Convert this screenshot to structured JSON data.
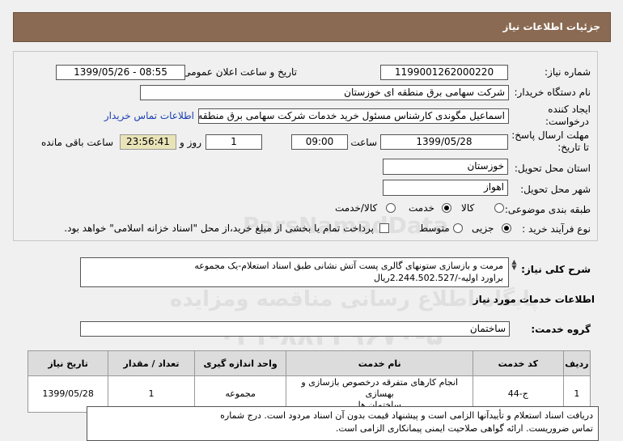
{
  "header": {
    "title": "جزئیات اطلاعات نیاز"
  },
  "form": {
    "need_number_label": "شماره نیاز:",
    "need_number": "1199001262000220",
    "announce_label": "تاریخ و ساعت اعلان عمومی:",
    "announce_value": "1399/05/26 - 08:55",
    "buyer_label": "نام دستگاه خریدار:",
    "buyer_value": "شرکت سهامی برق منطقه ای خوزستان",
    "creator_label_1": "ایجاد کننده",
    "creator_label_2": "درخواست:",
    "creator_value": "اسماعیل مگوندی کارشناس مسئول خرید خدمات شرکت سهامی برق منطقه ای خوزستان",
    "contact_link": "اطلاعات تماس خریدار",
    "deadline_label_1": "مهلت ارسال پاسخ:",
    "deadline_label_2": "تا تاریخ:",
    "deadline_date": "1399/05/28",
    "time_label": "ساعت",
    "deadline_time": "09:00",
    "days_value": "1",
    "days_label": "روز و",
    "countdown": "23:56:41",
    "remaining_label": "ساعت باقی مانده",
    "province_label": "استان محل تحویل:",
    "province_value": "خوزستان",
    "city_label": "شهر محل تحویل:",
    "city_value": "اهواز",
    "category_label": "طبقه بندی موضوعی:",
    "category_options": [
      "کالا",
      "خدمت",
      "کالا/خدمت"
    ],
    "category_selected": "خدمت",
    "process_label": "نوع فرآیند خرید :",
    "process_options": [
      "جزیی",
      "متوسط"
    ],
    "process_selected": "جزیی",
    "payment_note": "پرداخت تمام یا بخشی از مبلغ خرید،از محل \"اسناد خزانه اسلامی\" خواهد بود."
  },
  "description": {
    "label": "شرح کلی نیاز:",
    "line1": "مرمت و بازسازی ستونهای گالری پست آتش نشانی طبق اسناد استعلام-یک مجموعه",
    "line2": "براورد اولیه-/2.244.502.527ریال"
  },
  "services": {
    "section_title": "اطلاعات خدمات مورد نیاز",
    "group_label": "گروه خدمت:",
    "group_value": "ساختمان",
    "columns": [
      "ردیف",
      "کد خدمت",
      "نام خدمت",
      "واحد اندازه گیری",
      "تعداد / مقدار",
      "تاریخ نیاز"
    ],
    "row": {
      "index": "1",
      "code": "ج-44",
      "name_line1": "انجام کارهای متفرقه درخصوص بازسازی و بهسازی",
      "name_line2": "ساختمان ها",
      "unit": "مجموعه",
      "qty": "1",
      "date": "1399/05/28"
    }
  },
  "note": {
    "line1": "دریافت اسناد استعلام و تأییدآنها الزامی است و پیشنهاد قیمت بدون آن اسناد مردود است. درج شماره",
    "line2": "تماس ضروریست. ارائه گواهی صلاحیت ایمنی پیمانکاری الزامی است."
  },
  "watermark": {
    "brand": "ParsNamadData",
    "line1": "پایگاه اطلاع رسانی مناقصه ومزایده",
    "line2": "۰۲۱-۸۸۳۴۹۶۷۰-۵"
  }
}
